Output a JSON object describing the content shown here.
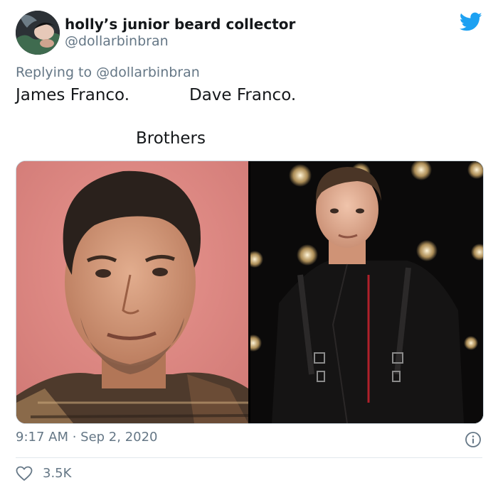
{
  "user": {
    "display_name": "holly’s junior beard collector",
    "handle": "@dollarbinbran"
  },
  "reply": {
    "prefix": "Replying to",
    "mention": "@dollarbinbran"
  },
  "text": {
    "left_label": "James Franco.",
    "right_label": "Dave Franco.",
    "caption": "Brothers"
  },
  "meta": {
    "timestamp": "9:17 AM · Sep 2, 2020",
    "likes": "3.5K"
  },
  "icons": {
    "brand": "twitter-bird-icon",
    "info": "info-icon",
    "like": "heart-icon"
  },
  "colors": {
    "brand_blue": "#1da1f2",
    "secondary_text": "#657786",
    "primary_text": "#14171a",
    "divider": "#e1e8ed"
  }
}
